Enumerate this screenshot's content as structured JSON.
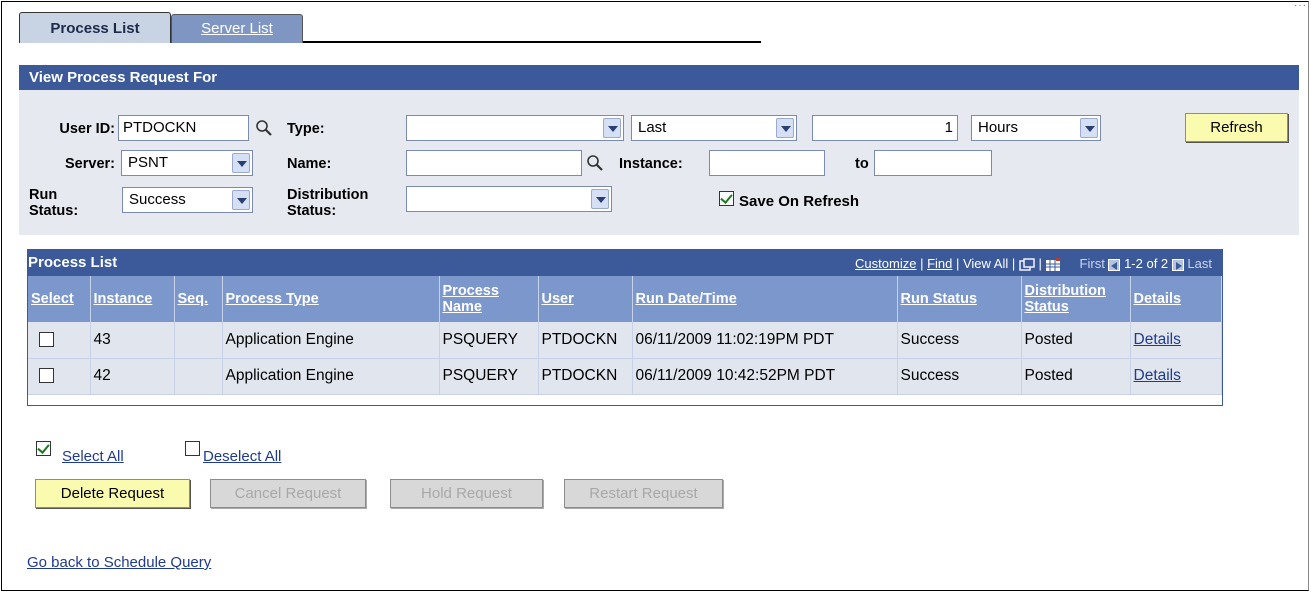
{
  "tabs": [
    {
      "label": "Process List",
      "active": true
    },
    {
      "label": "Server List",
      "active": false
    }
  ],
  "filter": {
    "header": "View Process Request For",
    "user_id_label": "User ID:",
    "user_id_value": "PTDOCKN",
    "type_label": "Type:",
    "type_value": "",
    "period_value": "Last",
    "period_count": "1",
    "period_unit": "Hours",
    "refresh_label": "Refresh",
    "server_label": "Server:",
    "server_value": "PSNT",
    "name_label": "Name:",
    "name_value": "",
    "instance_label": "Instance:",
    "instance_from": "",
    "to_label": "to",
    "instance_to": "",
    "run_status_label_1": "Run",
    "run_status_label_2": "Status:",
    "run_status_value": "Success",
    "dist_status_label_1": "Distribution",
    "dist_status_label_2": "Status:",
    "dist_status_value": "",
    "save_on_refresh_label": "Save On Refresh",
    "save_on_refresh_checked": true
  },
  "grid": {
    "title": "Process List",
    "customize": "Customize",
    "find": "Find",
    "view_all": "View All",
    "first": "First",
    "range": "1-2 of 2",
    "last": "Last",
    "columns": {
      "select": "Select",
      "instance": "Instance",
      "seq": "Seq.",
      "process_type": "Process Type",
      "process_name": "Process Name",
      "user": "User",
      "run_datetime": "Run Date/Time",
      "run_status": "Run Status",
      "distribution_status": "Distribution Status",
      "details": "Details"
    },
    "rows": [
      {
        "instance": "43",
        "seq": "",
        "process_type": "Application Engine",
        "process_name": "PSQUERY",
        "user": "PTDOCKN",
        "run_datetime": "06/11/2009 11:02:19PM PDT",
        "run_status": "Success",
        "distribution_status": "Posted",
        "details": "Details"
      },
      {
        "instance": "42",
        "seq": "",
        "process_type": "Application Engine",
        "process_name": "PSQUERY",
        "user": "PTDOCKN",
        "run_datetime": "06/11/2009 10:42:52PM PDT",
        "run_status": "Success",
        "distribution_status": "Posted",
        "details": "Details"
      }
    ]
  },
  "actions": {
    "select_all": "Select All",
    "deselect_all": "Deselect All",
    "delete_request": "Delete Request",
    "cancel_request": "Cancel Request",
    "hold_request": "Hold Request",
    "restart_request": "Restart Request"
  },
  "footer": {
    "back_link": "Go back to Schedule Query"
  },
  "colors": {
    "header_blue": "#3c5a9a",
    "column_header": "#7b97cb",
    "button_yellow": "#fbfbb0",
    "link": "#1f3b8f"
  }
}
